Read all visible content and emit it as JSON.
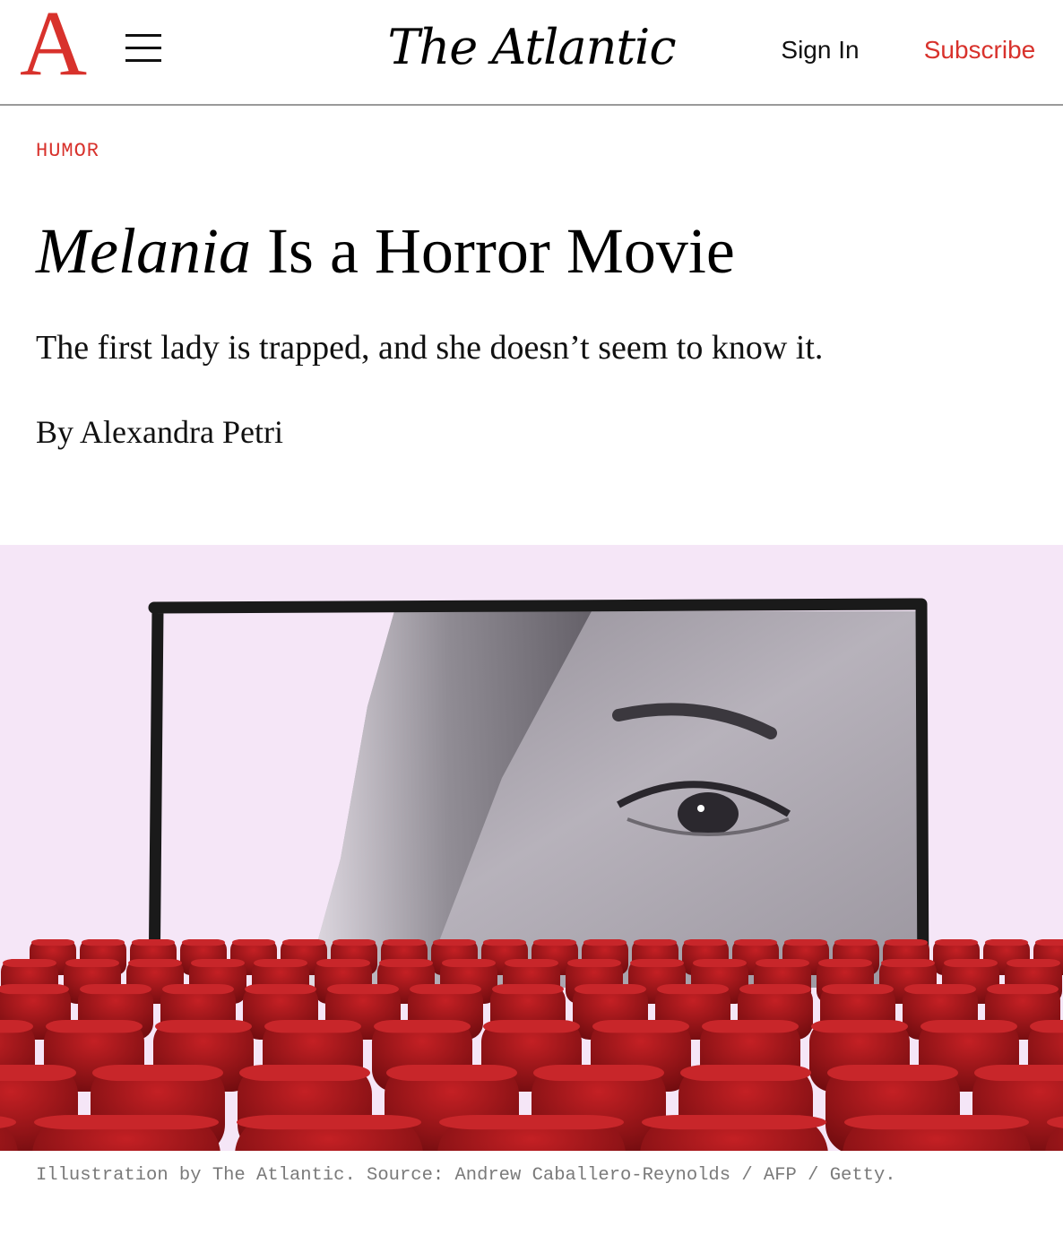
{
  "header": {
    "logo_letter": "A",
    "brand": "The Atlantic",
    "sign_in": "Sign In",
    "subscribe": "Subscribe",
    "accent_color": "#d8322c"
  },
  "article": {
    "section": "HUMOR",
    "title_italic": "Melania",
    "title_rest": " Is a Horror Movie",
    "dek": "The first lady is trapped, and she doesn’t seem to know it.",
    "byline_prefix": "By ",
    "author": "Alexandra Petri",
    "caption": "Illustration by The Atlantic. Source: Andrew Caballero-Reynolds / AFP / Getty."
  },
  "hero": {
    "background_color": "#f5e6f7",
    "seat_color": "#a8171b"
  },
  "icons": [
    "logo-a-icon",
    "hamburger-menu-icon"
  ]
}
